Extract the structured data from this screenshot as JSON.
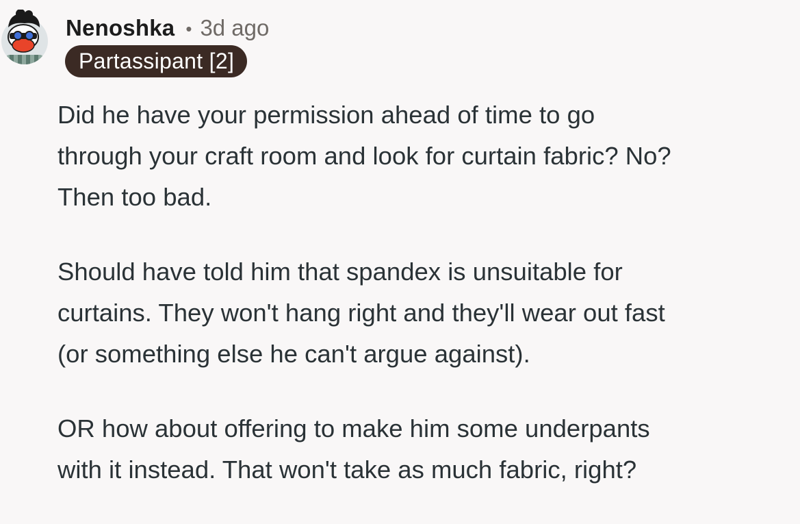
{
  "comment": {
    "author": "Nenoshka",
    "separator": "•",
    "timestamp": "3d ago",
    "flair": "Partassipant [2]",
    "paragraphs": [
      {
        "lines": [
          "Did he have your permission ahead of time to go",
          "through your craft room and look for curtain fabric? No?",
          "Then too bad."
        ]
      },
      {
        "lines": [
          "Should have told him that spandex is unsuitable for",
          "curtains. They won't hang right and they'll wear out fast",
          "(or something else he can't argue against)."
        ]
      },
      {
        "lines": [
          "OR how about offering to make him some underpants",
          "with it instead. That won't take as much fabric, right?"
        ]
      }
    ]
  },
  "colors": {
    "background": "#f9f7f7",
    "username": "#1c1c1c",
    "meta": "#6f6a66",
    "flair_bg": "#3b2a24",
    "flair_text": "#ffffff",
    "body_text": "#2a3236"
  },
  "icons": {
    "avatar": "snoo-avatar-icon"
  }
}
